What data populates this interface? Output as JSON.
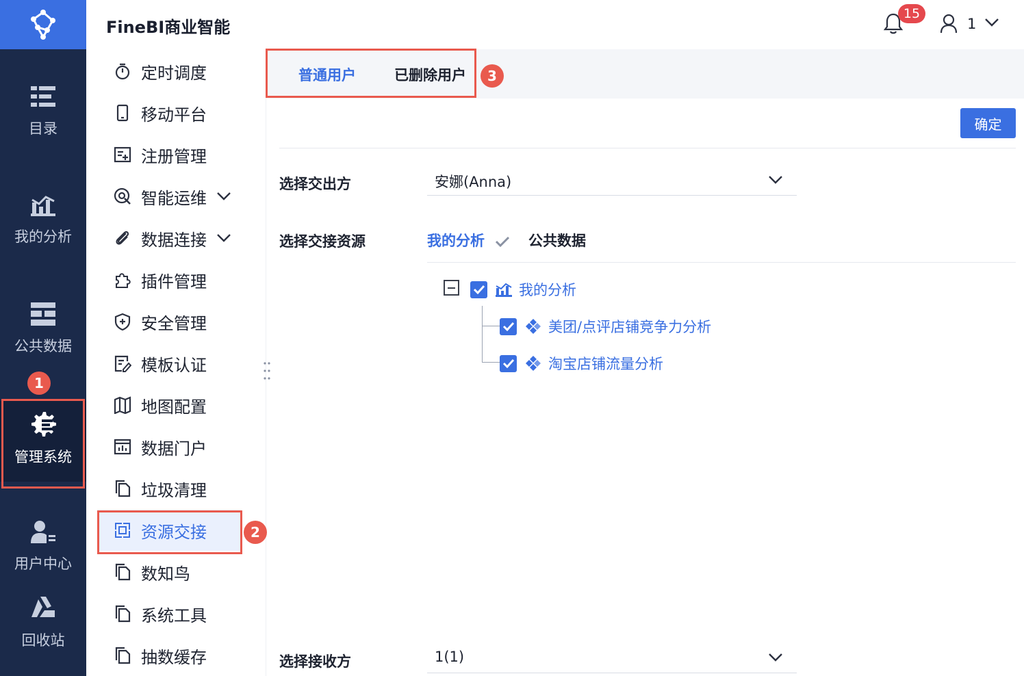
{
  "app": {
    "title": "FineBI商业智能"
  },
  "header": {
    "notification_count": "15",
    "user_name": "1",
    "icons": [
      "bell-icon",
      "user-icon",
      "chevron-down-icon"
    ]
  },
  "rail": {
    "items": [
      {
        "label": "目录",
        "icon": "catalog-icon"
      },
      {
        "label": "我的分析",
        "icon": "analysis-chart-icon"
      },
      {
        "label": "公共数据",
        "icon": "public-data-icon"
      },
      {
        "label": "管理系统",
        "icon": "gear-icon",
        "active": true
      },
      {
        "label": "用户中心",
        "icon": "user-center-icon"
      },
      {
        "label": "回收站",
        "icon": "recycle-icon"
      }
    ]
  },
  "submenu": {
    "items": [
      {
        "label": "定时调度",
        "icon": "stopwatch-icon"
      },
      {
        "label": "移动平台",
        "icon": "mobile-icon"
      },
      {
        "label": "注册管理",
        "icon": "register-icon"
      },
      {
        "label": "智能运维",
        "icon": "ops-icon",
        "expandable": true
      },
      {
        "label": "数据连接",
        "icon": "paperclip-icon",
        "expandable": true
      },
      {
        "label": "插件管理",
        "icon": "puzzle-icon"
      },
      {
        "label": "安全管理",
        "icon": "shield-icon"
      },
      {
        "label": "模板认证",
        "icon": "template-cert-icon"
      },
      {
        "label": "地图配置",
        "icon": "map-icon"
      },
      {
        "label": "数据门户",
        "icon": "portal-icon"
      },
      {
        "label": "垃圾清理",
        "icon": "copy-icon"
      },
      {
        "label": "资源交接",
        "icon": "handover-icon",
        "active": true
      },
      {
        "label": "数知鸟",
        "icon": "copy-icon"
      },
      {
        "label": "系统工具",
        "icon": "copy-icon"
      },
      {
        "label": "抽数缓存",
        "icon": "copy-icon"
      }
    ]
  },
  "tabs": [
    {
      "label": "普通用户",
      "active": true
    },
    {
      "label": "已删除用户",
      "active": false
    }
  ],
  "confirm_label": "确定",
  "form": {
    "from_label": "选择交出方",
    "from_value": "安娜(Anna)",
    "resource_label": "选择交接资源",
    "resource_tabs": [
      {
        "label": "我的分析",
        "active": true
      },
      {
        "label": "公共数据",
        "active": false
      }
    ],
    "to_label": "选择接收方",
    "to_value": "1(1)"
  },
  "tree": {
    "root": {
      "label": "我的分析",
      "checked": true,
      "expanded": true
    },
    "children": [
      {
        "label": "美团/点评店铺竞争力分析",
        "checked": true
      },
      {
        "label": "淘宝店铺流量分析",
        "checked": true
      }
    ]
  },
  "markers": [
    "1",
    "2",
    "3"
  ],
  "colors": {
    "accent": "#3a6fe1",
    "rail_bg": "#1b2a4a",
    "highlight": "#e95a4e",
    "badge": "#e5484d"
  }
}
